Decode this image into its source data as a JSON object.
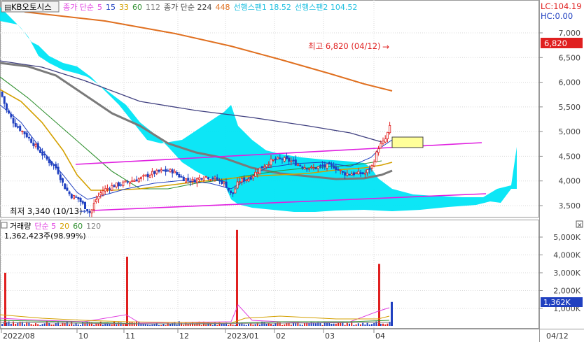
{
  "header": {
    "stock_name": "KB오토시스",
    "items": [
      {
        "text": "종가 단순",
        "color": "#e040e0"
      },
      {
        "text": "5",
        "color": "#e040e0"
      },
      {
        "text": "15",
        "color": "#2040c0"
      },
      {
        "text": "33",
        "color": "#d4a000"
      },
      {
        "text": "60",
        "color": "#309030"
      },
      {
        "text": "112",
        "color": "#808080"
      },
      {
        "text": "종가 단순 224",
        "color": "#404040"
      },
      {
        "text": "448",
        "color": "#e07020"
      },
      {
        "text": "선행스팬1 18.52",
        "color": "#20c0e0"
      },
      {
        "text": "선행스팬2 104.52",
        "color": "#20c0e0"
      }
    ],
    "lc_label": "LC:104.19",
    "hc_label": "HC:0.00"
  },
  "annotations": {
    "high": "최고 6,820 (04/12)",
    "low": "최저 3,340 (10/13)",
    "price_badge": "6,820",
    "volume_badge": "1,362K"
  },
  "volume_header": {
    "title": "거래량",
    "legend": [
      {
        "text": "단순 5",
        "color": "#e040e0"
      },
      {
        "text": "20",
        "color": "#d4a000"
      },
      {
        "text": "60",
        "color": "#309030"
      },
      {
        "text": "120",
        "color": "#808080"
      }
    ],
    "info": "1,362,423주(98.99%)"
  },
  "x_axis": {
    "labels": [
      "2022/08",
      "10",
      "11",
      "12",
      "2023/01",
      "02",
      "03",
      "04"
    ],
    "right_label": "04/12"
  },
  "colors": {
    "up": "#e02020",
    "down": "#2040c0",
    "cloud": "#00e5f5",
    "trend": "#e020e0"
  },
  "chart_data": {
    "type": "candlestick",
    "price_axis": {
      "ticks": [
        3500,
        4000,
        4500,
        5000,
        5500,
        6000,
        6500,
        7000
      ],
      "tick_labels": [
        "3,500",
        "4,000",
        "4,500",
        "5,000",
        "5,500",
        "6,000",
        "6,500",
        "7,000"
      ],
      "range": [
        3300,
        7200
      ]
    },
    "volume_axis": {
      "ticks": [
        1000,
        2000,
        3000,
        4000,
        5000
      ],
      "tick_labels": [
        "1,000K",
        "2,000K",
        "3,000K",
        "4,000K",
        "5,000K"
      ],
      "range": [
        0,
        5600
      ]
    },
    "close_path": [
      [
        0,
        5800
      ],
      [
        8,
        5450
      ],
      [
        20,
        5150
      ],
      [
        35,
        4950
      ],
      [
        50,
        4700
      ],
      [
        65,
        4450
      ],
      [
        80,
        4250
      ],
      [
        90,
        3900
      ],
      [
        100,
        3700
      ],
      [
        110,
        3650
      ],
      [
        120,
        3480
      ],
      [
        128,
        3340
      ],
      [
        135,
        3600
      ],
      [
        145,
        3800
      ],
      [
        160,
        3900
      ],
      [
        175,
        3950
      ],
      [
        185,
        4000
      ],
      [
        200,
        4050
      ],
      [
        215,
        4150
      ],
      [
        230,
        4200
      ],
      [
        245,
        4200
      ],
      [
        260,
        4050
      ],
      [
        275,
        4000
      ],
      [
        290,
        4100
      ],
      [
        305,
        4050
      ],
      [
        320,
        3950
      ],
      [
        330,
        3700
      ],
      [
        340,
        4000
      ],
      [
        355,
        4050
      ],
      [
        370,
        4250
      ],
      [
        385,
        4400
      ],
      [
        400,
        4450
      ],
      [
        415,
        4400
      ],
      [
        430,
        4300
      ],
      [
        445,
        4250
      ],
      [
        460,
        4300
      ],
      [
        475,
        4300
      ],
      [
        490,
        4150
      ],
      [
        505,
        4150
      ],
      [
        520,
        4150
      ],
      [
        530,
        4300
      ],
      [
        540,
        4700
      ],
      [
        548,
        4800
      ],
      [
        556,
        5100
      ]
    ],
    "volume_spikes": [
      [
        6,
        3000
      ],
      [
        180,
        3900
      ],
      [
        337,
        5400
      ],
      [
        540,
        3500
      ],
      [
        558,
        1362
      ]
    ]
  }
}
